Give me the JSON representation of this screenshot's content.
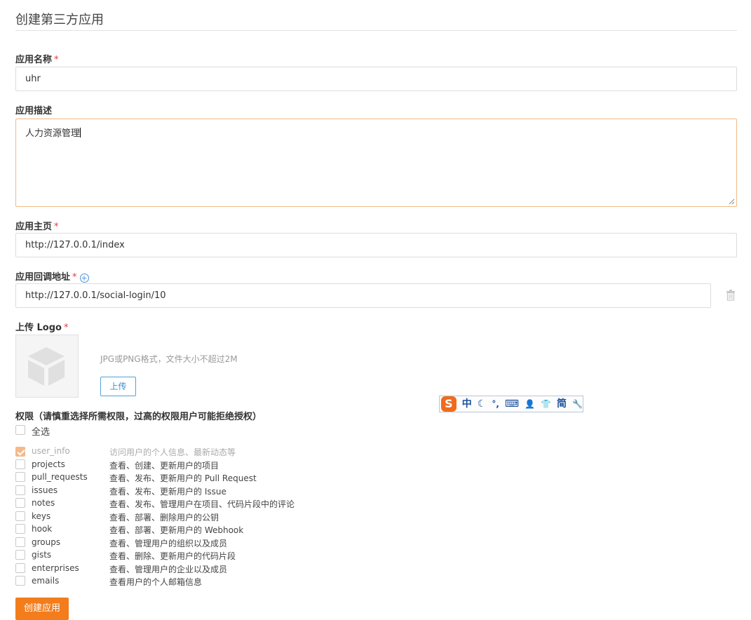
{
  "page_title": "创建第三方应用",
  "required_mark": "*",
  "app_name": {
    "label": "应用名称",
    "value": "uhr"
  },
  "app_desc": {
    "label": "应用描述",
    "value": "人力资源管理"
  },
  "homepage": {
    "label": "应用主页",
    "value": "http://127.0.0.1/index"
  },
  "callback": {
    "label": "应用回调地址",
    "add_icon": "plus-circle-icon",
    "value": "http://127.0.0.1/social-login/10",
    "delete_icon": "trash-icon"
  },
  "logo": {
    "label": "上传 Logo",
    "hint": "JPG或PNG格式，文件大小不超过2M",
    "upload_label": "上传",
    "placeholder_icon": "cube-icon"
  },
  "ime_toolbar": {
    "logo": "S",
    "items": [
      "中",
      "☾",
      "°,",
      "⌨",
      "👤",
      "👕",
      "简",
      "🔧"
    ]
  },
  "permissions": {
    "title": "权限（请慎重选择所需权限，过高的权限用户可能拒绝授权）",
    "select_all": "全选",
    "items": [
      {
        "name": "user_info",
        "desc": "访问用户的个人信息、最新动态等",
        "checked": true,
        "disabled": true
      },
      {
        "name": "projects",
        "desc": "查看、创建、更新用户的项目",
        "checked": false,
        "disabled": false
      },
      {
        "name": "pull_requests",
        "desc": "查看、发布、更新用户的 Pull Request",
        "checked": false,
        "disabled": false
      },
      {
        "name": "issues",
        "desc": "查看、发布、更新用户的 Issue",
        "checked": false,
        "disabled": false
      },
      {
        "name": "notes",
        "desc": "查看、发布、管理用户在项目、代码片段中的评论",
        "checked": false,
        "disabled": false
      },
      {
        "name": "keys",
        "desc": "查看、部署、删除用户的公钥",
        "checked": false,
        "disabled": false
      },
      {
        "name": "hook",
        "desc": "查看、部署、更新用户的 Webhook",
        "checked": false,
        "disabled": false
      },
      {
        "name": "groups",
        "desc": "查看、管理用户的组织以及成员",
        "checked": false,
        "disabled": false
      },
      {
        "name": "gists",
        "desc": "查看、删除、更新用户的代码片段",
        "checked": false,
        "disabled": false
      },
      {
        "name": "enterprises",
        "desc": "查看、管理用户的企业以及成员",
        "checked": false,
        "disabled": false
      },
      {
        "name": "emails",
        "desc": "查看用户的个人邮箱信息",
        "checked": false,
        "disabled": false
      }
    ]
  },
  "submit_label": "创建应用",
  "colors": {
    "accent": "#f37d1c",
    "required": "#e4393c",
    "link": "#4a90d9"
  }
}
